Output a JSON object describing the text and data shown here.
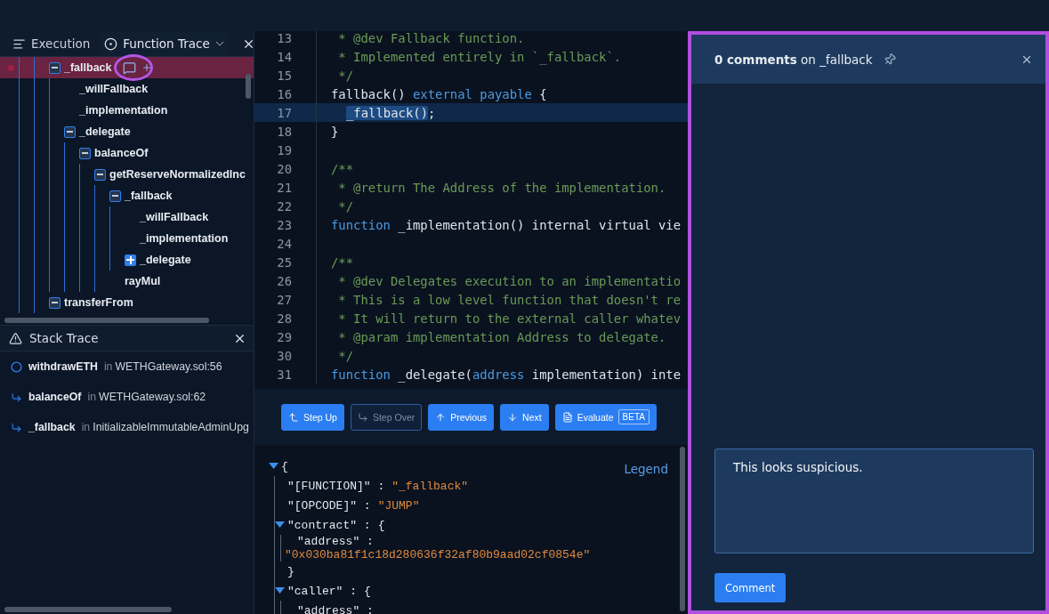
{
  "left_panel": {
    "tabs": [
      {
        "label": "Execution",
        "kind": "execution",
        "selected": false
      },
      {
        "label": "Function Trace",
        "kind": "trace",
        "selected": true
      }
    ],
    "tree": [
      {
        "label": "_fallback",
        "selected": true,
        "expanded": true,
        "children": [
          {
            "label": "_willFallback"
          },
          {
            "label": "_implementation"
          },
          {
            "label": "_delegate",
            "expanded": true,
            "children": [
              {
                "label": "balanceOf",
                "expanded": true,
                "children": [
                  {
                    "label": "getReserveNormalizedInc",
                    "expanded": true,
                    "children": [
                      {
                        "label": "_fallback",
                        "expanded": true,
                        "children": [
                          {
                            "label": "_willFallback"
                          },
                          {
                            "label": "_implementation"
                          },
                          {
                            "label": "_delegate",
                            "expanded": false
                          }
                        ]
                      },
                      {
                        "label": "rayMul"
                      }
                    ]
                  }
                ]
              }
            ]
          }
        ]
      },
      {
        "label": "transferFrom",
        "selected": false,
        "expanded": true
      }
    ]
  },
  "stack_trace": {
    "title": "Stack Trace",
    "frames": [
      {
        "kind": "current",
        "function": "withdrawETH",
        "in": "in",
        "file": "WETHGateway.sol:56"
      },
      {
        "kind": "call",
        "function": "balanceOf",
        "in": "in",
        "file": "WETHGateway.sol:62"
      },
      {
        "kind": "call",
        "function": "_fallback",
        "in": "in",
        "file": "InitializableImmutableAdminUpg"
      }
    ]
  },
  "code": {
    "lines": [
      {
        "number": "13",
        "selected": false,
        "tokens": [
          {
            "kind": "comment",
            "text": " * @dev Fallback function."
          }
        ]
      },
      {
        "number": "14",
        "selected": false,
        "tokens": [
          {
            "kind": "comment",
            "text": " * Implemented entirely in `_fallback`."
          }
        ]
      },
      {
        "number": "15",
        "selected": false,
        "tokens": [
          {
            "kind": "comment",
            "text": " */"
          }
        ]
      },
      {
        "number": "16",
        "selected": false,
        "tokens": [
          {
            "kind": "plain",
            "text": "fallback() "
          },
          {
            "kind": "keyword",
            "text": "external payable"
          },
          {
            "kind": "plain",
            "text": " {"
          }
        ]
      },
      {
        "number": "17",
        "selected": true,
        "indented": true,
        "tokens": [
          {
            "kind": "selection",
            "text": "_fallback()"
          },
          {
            "kind": "plain",
            "text": ";"
          }
        ]
      },
      {
        "number": "18",
        "selected": false,
        "tokens": [
          {
            "kind": "plain",
            "text": "}"
          }
        ]
      },
      {
        "number": "19",
        "selected": false
      },
      {
        "number": "20",
        "selected": false,
        "tokens": [
          {
            "kind": "comment",
            "text": "/**"
          }
        ]
      },
      {
        "number": "21",
        "selected": false,
        "tokens": [
          {
            "kind": "comment",
            "text": " * @return The Address of the implementation."
          }
        ]
      },
      {
        "number": "22",
        "selected": false,
        "tokens": [
          {
            "kind": "comment",
            "text": " */"
          }
        ]
      },
      {
        "number": "23",
        "selected": false,
        "tokens": [
          {
            "kind": "keyword",
            "text": "function"
          },
          {
            "kind": "plain",
            "text": " _implementation() internal virtual vie"
          }
        ]
      },
      {
        "number": "24",
        "selected": false
      },
      {
        "number": "25",
        "selected": false,
        "tokens": [
          {
            "kind": "comment",
            "text": "/**"
          }
        ]
      },
      {
        "number": "26",
        "selected": false,
        "tokens": [
          {
            "kind": "comment",
            "text": " * @dev Delegates execution to an implementatio"
          }
        ]
      },
      {
        "number": "27",
        "selected": false,
        "tokens": [
          {
            "kind": "comment",
            "text": " * This is a low level function that doesn't re"
          }
        ]
      },
      {
        "number": "28",
        "selected": false,
        "tokens": [
          {
            "kind": "comment",
            "text": " * It will return to the external caller whatev"
          }
        ]
      },
      {
        "number": "29",
        "selected": false,
        "tokens": [
          {
            "kind": "comment",
            "text": " * @param implementation Address to delegate."
          }
        ]
      },
      {
        "number": "30",
        "selected": false,
        "tokens": [
          {
            "kind": "comment",
            "text": " */"
          }
        ]
      },
      {
        "number": "31",
        "selected": false,
        "tokens": [
          {
            "kind": "keyword",
            "text": "function"
          },
          {
            "kind": "plain",
            "text": " _delegate("
          },
          {
            "kind": "type",
            "text": "address"
          },
          {
            "kind": "plain",
            "text": " implementation) inte"
          }
        ]
      }
    ]
  },
  "debug_buttons": [
    {
      "kind": "up",
      "label": "Step Up",
      "disabled": false
    },
    {
      "kind": "over",
      "label": "Step Over",
      "disabled": true
    },
    {
      "kind": "previous",
      "label": "Previous",
      "disabled": false
    },
    {
      "kind": "next",
      "label": "Next",
      "disabled": false
    },
    {
      "kind": "evaluate",
      "label": "Evaluate",
      "badge": "BETA",
      "disabled": false
    }
  ],
  "json_view": {
    "legend": "Legend",
    "root": {
      "open": "{",
      "expanded": true,
      "children": [
        {
          "key": "\"[FUNCTION]\" :",
          "value": "\"_fallback\""
        },
        {
          "key": "\"[OPCODE]\" :",
          "value": "\"JUMP\""
        },
        {
          "key": "\"contract\" :",
          "open": "{",
          "expanded": true,
          "close": "}",
          "children": [
            {
              "key": "\"address\" :",
              "value": "\"0x030ba81f1c18d280636f32af80b9aad02cf0854e\""
            }
          ]
        },
        {
          "key": "\"caller\" :",
          "open": "{",
          "expanded": true,
          "children": [
            {
              "key": "\"address\" :"
            }
          ]
        }
      ]
    }
  },
  "comments_panel": {
    "title": "**0 comments** on _fallback",
    "comment_field": {
      "value": "This looks suspicious."
    },
    "submit": "Comment"
  }
}
